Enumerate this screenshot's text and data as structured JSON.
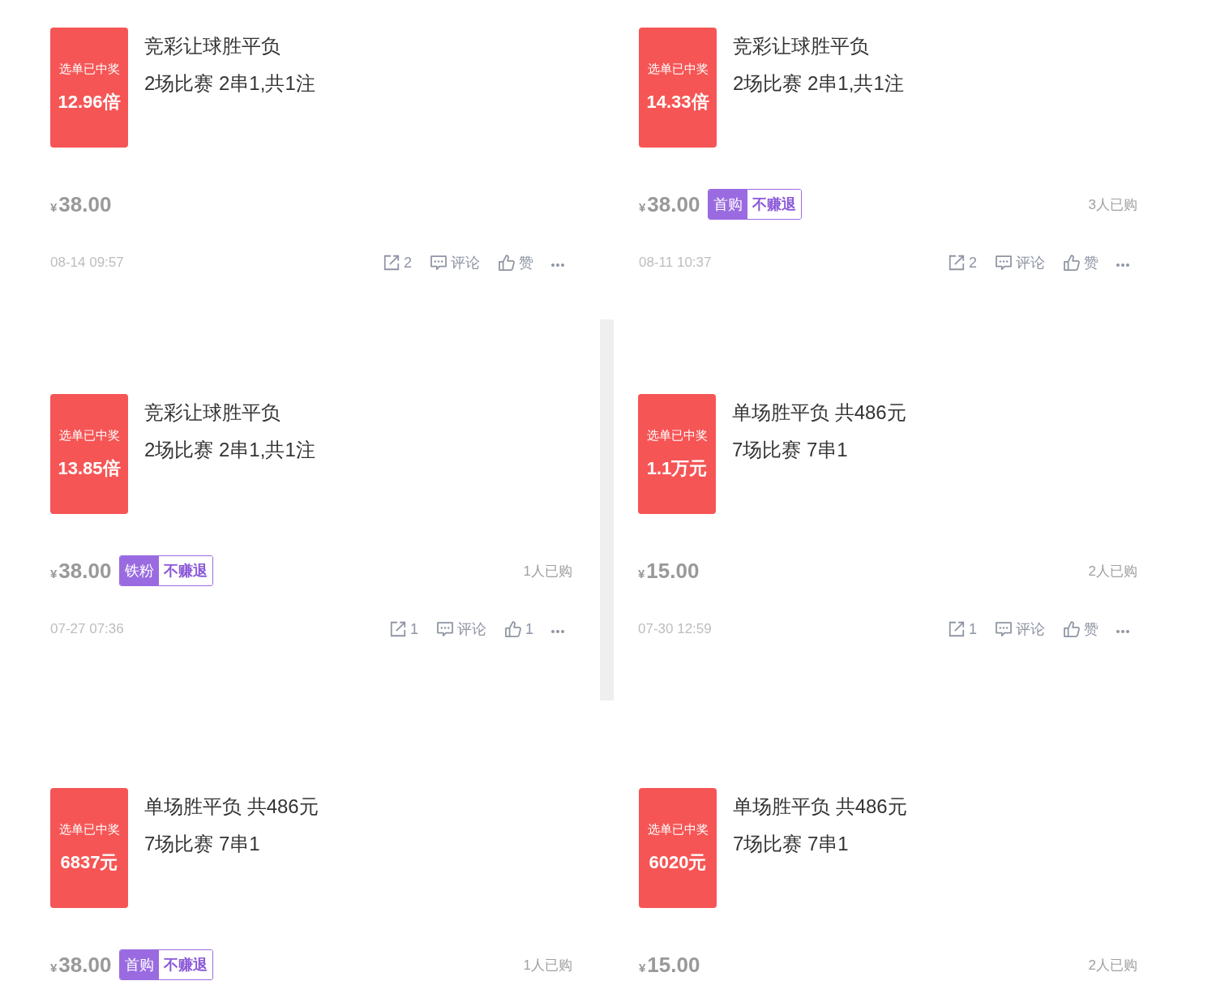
{
  "cards": [
    {
      "badge": {
        "caption": "选单已中奖",
        "value": "12.96倍"
      },
      "title": "竞彩让球胜平负",
      "subtitle": "2场比赛 2串1,共1注",
      "price": {
        "currency": "¥",
        "amount": "38.00"
      },
      "time": "08-14 09:57",
      "actions": [
        {
          "kind": "share",
          "label": "2"
        },
        {
          "kind": "comment",
          "label": "评论"
        },
        {
          "kind": "like",
          "label": "赞"
        },
        {
          "kind": "more"
        }
      ]
    },
    {
      "badge": {
        "caption": "选单已中奖",
        "value": "14.33倍"
      },
      "title": "竞彩让球胜平负",
      "subtitle": "2场比赛 2串1,共1注",
      "price": {
        "currency": "¥",
        "amount": "38.00"
      },
      "tag": {
        "type": "首购",
        "note": "不赚退"
      },
      "buyers": "3人已购",
      "time": "08-11 10:37",
      "actions": [
        {
          "kind": "share",
          "label": "2"
        },
        {
          "kind": "comment",
          "label": "评论"
        },
        {
          "kind": "like",
          "label": "赞"
        },
        {
          "kind": "more"
        }
      ]
    },
    {
      "badge": {
        "caption": "选单已中奖",
        "value": "13.85倍"
      },
      "title": "竞彩让球胜平负",
      "subtitle": "2场比赛 2串1,共1注",
      "price": {
        "currency": "¥",
        "amount": "38.00"
      },
      "tag": {
        "type": "铁粉",
        "note": "不赚退"
      },
      "buyers": "1人已购",
      "time": "07-27 07:36",
      "actions": [
        {
          "kind": "share",
          "label": "1"
        },
        {
          "kind": "comment",
          "label": "评论"
        },
        {
          "kind": "like",
          "label": "1"
        },
        {
          "kind": "more"
        }
      ]
    },
    {
      "badge": {
        "caption": "选单已中奖",
        "value": "1.1万元"
      },
      "title": "单场胜平负 共486元",
      "subtitle": "7场比赛 7串1",
      "price": {
        "currency": "¥",
        "amount": "15.00"
      },
      "buyers": "2人已购",
      "time": "07-30 12:59",
      "actions": [
        {
          "kind": "share",
          "label": "1"
        },
        {
          "kind": "comment",
          "label": "评论"
        },
        {
          "kind": "like",
          "label": "赞"
        },
        {
          "kind": "more"
        }
      ]
    },
    {
      "badge": {
        "caption": "选单已中奖",
        "value": "6837元"
      },
      "title": "单场胜平负 共486元",
      "subtitle": "7场比赛 7串1",
      "price": {
        "currency": "¥",
        "amount": "38.00"
      },
      "tag": {
        "type": "首购",
        "note": "不赚退"
      },
      "buyers": "1人已购"
    },
    {
      "badge": {
        "caption": "选单已中奖",
        "value": "6020元"
      },
      "title": "单场胜平负 共486元",
      "subtitle": "7场比赛 7串1",
      "price": {
        "currency": "¥",
        "amount": "15.00"
      },
      "buyers": "2人已购"
    }
  ]
}
